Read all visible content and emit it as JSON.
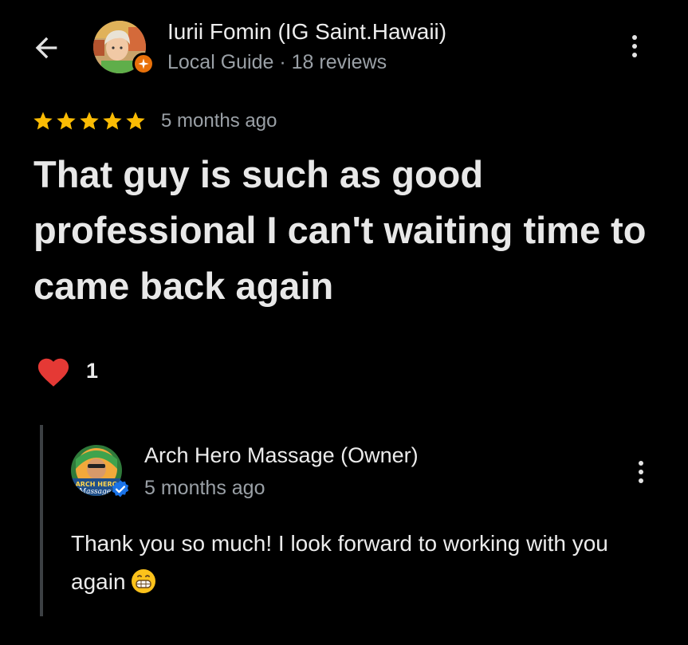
{
  "header": {
    "back_icon": "arrow-left-icon",
    "reviewer_name": "Iurii Fomin (IG Saint.Hawaii)",
    "reviewer_meta": "Local Guide · 18 reviews",
    "badge_icon": "local-guide-star-icon",
    "more_icon": "more-vert-icon"
  },
  "review": {
    "rating": 5,
    "rating_max": 5,
    "time": "5 months ago",
    "text": "That guy is such as good professional I can't waiting time to came back again",
    "reaction_icon": "red-heart-icon",
    "reaction_count": "1"
  },
  "owner_reply": {
    "name": "Arch Hero Massage (Owner)",
    "time": "5 months ago",
    "text": "Thank you so much! I look forward to working with you again",
    "emoji_icon": "grinning-face-emoji",
    "avatar_logo_text": "ARCH HERO Massage",
    "verified_icon": "verified-check-icon",
    "more_icon": "more-vert-icon"
  },
  "colors": {
    "background": "#000000",
    "primary_text": "#e8e8e8",
    "secondary_text": "#9aa0a6",
    "star": "#fbbc04",
    "heart": "#e53935",
    "local_guide_badge": "#e8710a",
    "verified": "#1a73e8",
    "reply_bar": "#3c4043"
  }
}
